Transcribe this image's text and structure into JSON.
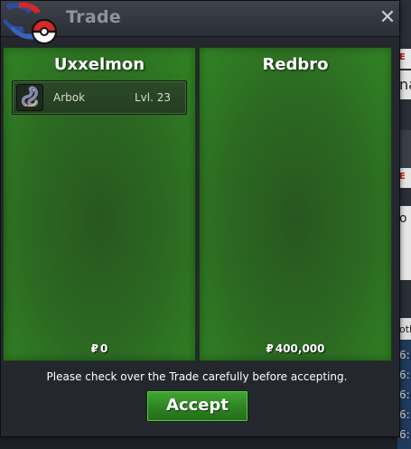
{
  "window": {
    "title": "Trade",
    "close_label": "✕"
  },
  "left_panel": {
    "player": "Uxxelmon",
    "pokemon": [
      {
        "name": "Arbok",
        "level": "Lvl. 23"
      }
    ],
    "money_symbol": "₽",
    "money": "0"
  },
  "right_panel": {
    "player": "Redbro",
    "money_symbol": "₽",
    "money": "400,000"
  },
  "footer": {
    "notice": "Please check over the Trade carefully before accepting.",
    "accept_label": "Accept"
  },
  "background_fragments": [
    "E",
    "na",
    "E",
    "o",
    "otl",
    "6:",
    "6:",
    "6:",
    "6:",
    "6:"
  ],
  "colors": {
    "panel_green": "#2c6a22",
    "accept_green": "#2d8322",
    "window_bg": "#24272e"
  }
}
